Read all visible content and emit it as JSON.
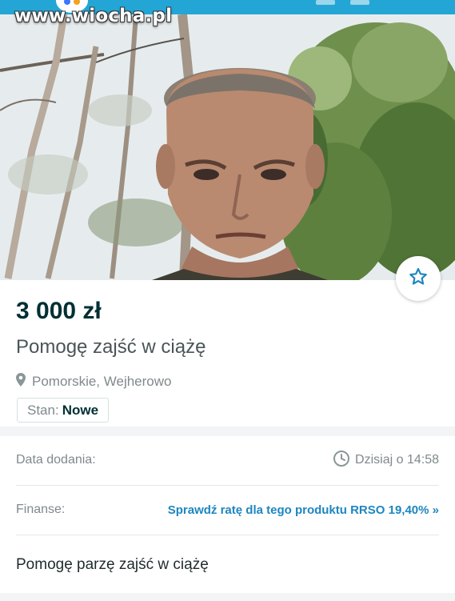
{
  "watermark": "www.wiocha.pl",
  "listing": {
    "price": "3 000 zł",
    "title": "Pomogę zajść w ciążę",
    "location": "Pomorskie, Wejherowo",
    "state_label": "Stan:",
    "state_value": "Nowe"
  },
  "details": {
    "date_label": "Data dodania:",
    "date_value": "Dzisiaj o 14:58",
    "finance_label": "Finanse:",
    "finance_link": "Sprawdź ratę dla tego produktu RRSO 19,40% »",
    "description": "Pomogę parzę zajść w ciążę"
  },
  "icons": {
    "favorite": "star-outline-icon",
    "location": "map-pin-icon",
    "date": "clock-icon"
  },
  "colors": {
    "brand_bar": "#23a6d5",
    "price_text": "#002f34",
    "link": "#1d86c0",
    "star": "#1d86c0"
  }
}
